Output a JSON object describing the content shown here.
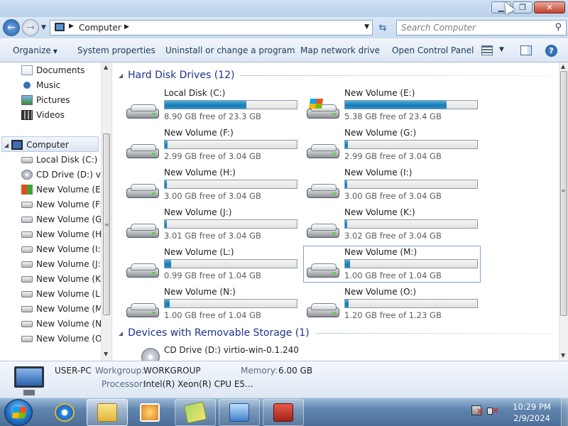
{
  "window": {
    "minimize_glyph": "▁",
    "maximize_glyph": "❐",
    "close_glyph": "✕"
  },
  "address": {
    "crumb": "Computer",
    "search_placeholder": "Search Computer"
  },
  "toolbar": {
    "organize": "Organize",
    "system_properties": "System properties",
    "uninstall": "Uninstall or change a program",
    "map_drive": "Map network drive",
    "control_panel": "Open Control Panel",
    "help": "?"
  },
  "nav": {
    "libraries": [
      {
        "label": "Documents",
        "icon": "document-icon"
      },
      {
        "label": "Music",
        "icon": "music-icon"
      },
      {
        "label": "Pictures",
        "icon": "pictures-icon"
      },
      {
        "label": "Videos",
        "icon": "videos-icon"
      }
    ],
    "computer": "Computer",
    "drives": [
      "Local Disk (C:)",
      "CD Drive (D:) virt",
      "New Volume (E:)",
      "New Volume (F:)",
      "New Volume (G:)",
      "New Volume (H:)",
      "New Volume (I:)",
      "New Volume (J:)",
      "New Volume (K:)",
      "New Volume (L:)",
      "New Volume (M:)",
      "New Volume (N:)",
      "New Volume (O:)"
    ]
  },
  "groups": {
    "hdd": "Hard Disk Drives (12)",
    "removable": "Devices with Removable Storage (1)"
  },
  "drives": [
    {
      "name": "Local Disk (C:)",
      "free": "8.90 GB free of 23.3 GB",
      "used_fraction": 0.62,
      "windows": false
    },
    {
      "name": "New Volume (E:)",
      "free": "5.38 GB free of 23.4 GB",
      "used_fraction": 0.77,
      "windows": true
    },
    {
      "name": "New Volume (F:)",
      "free": "2.99 GB free of 3.04 GB",
      "used_fraction": 0.02,
      "windows": false
    },
    {
      "name": "New Volume (G:)",
      "free": "2.99 GB free of 3.04 GB",
      "used_fraction": 0.02,
      "windows": false
    },
    {
      "name": "New Volume (H:)",
      "free": "3.00 GB free of 3.04 GB",
      "used_fraction": 0.015,
      "windows": false
    },
    {
      "name": "New Volume (I:)",
      "free": "3.00 GB free of 3.04 GB",
      "used_fraction": 0.015,
      "windows": false
    },
    {
      "name": "New Volume (J:)",
      "free": "3.01 GB free of 3.04 GB",
      "used_fraction": 0.012,
      "windows": false
    },
    {
      "name": "New Volume (K:)",
      "free": "3.02 GB free of 3.04 GB",
      "used_fraction": 0.01,
      "windows": false
    },
    {
      "name": "New Volume (L:)",
      "free": "0.99 GB free of 1.04 GB",
      "used_fraction": 0.05,
      "windows": false
    },
    {
      "name": "New Volume (M:)",
      "free": "1.00 GB free of 1.04 GB",
      "used_fraction": 0.04,
      "windows": false
    },
    {
      "name": "New Volume (N:)",
      "free": "1.00 GB free of 1.04 GB",
      "used_fraction": 0.04,
      "windows": false
    },
    {
      "name": "New Volume (O:)",
      "free": "1.20 GB free of 1.23 GB",
      "used_fraction": 0.025,
      "windows": false
    }
  ],
  "selected_drive": "New Volume (M:)",
  "cd": {
    "name": "CD Drive (D:) virtio-win-0.1.240"
  },
  "details": {
    "name": "USER-PC",
    "workgroup_label": "Workgroup:",
    "workgroup": "WORKGROUP",
    "memory_label": "Memory:",
    "memory": "6.00 GB",
    "processor_label": "Processor:",
    "processor": "Intel(R) Xeon(R) CPU E5..."
  },
  "taskbar": {
    "time": "10:29 PM",
    "date": "2/9/2024"
  }
}
